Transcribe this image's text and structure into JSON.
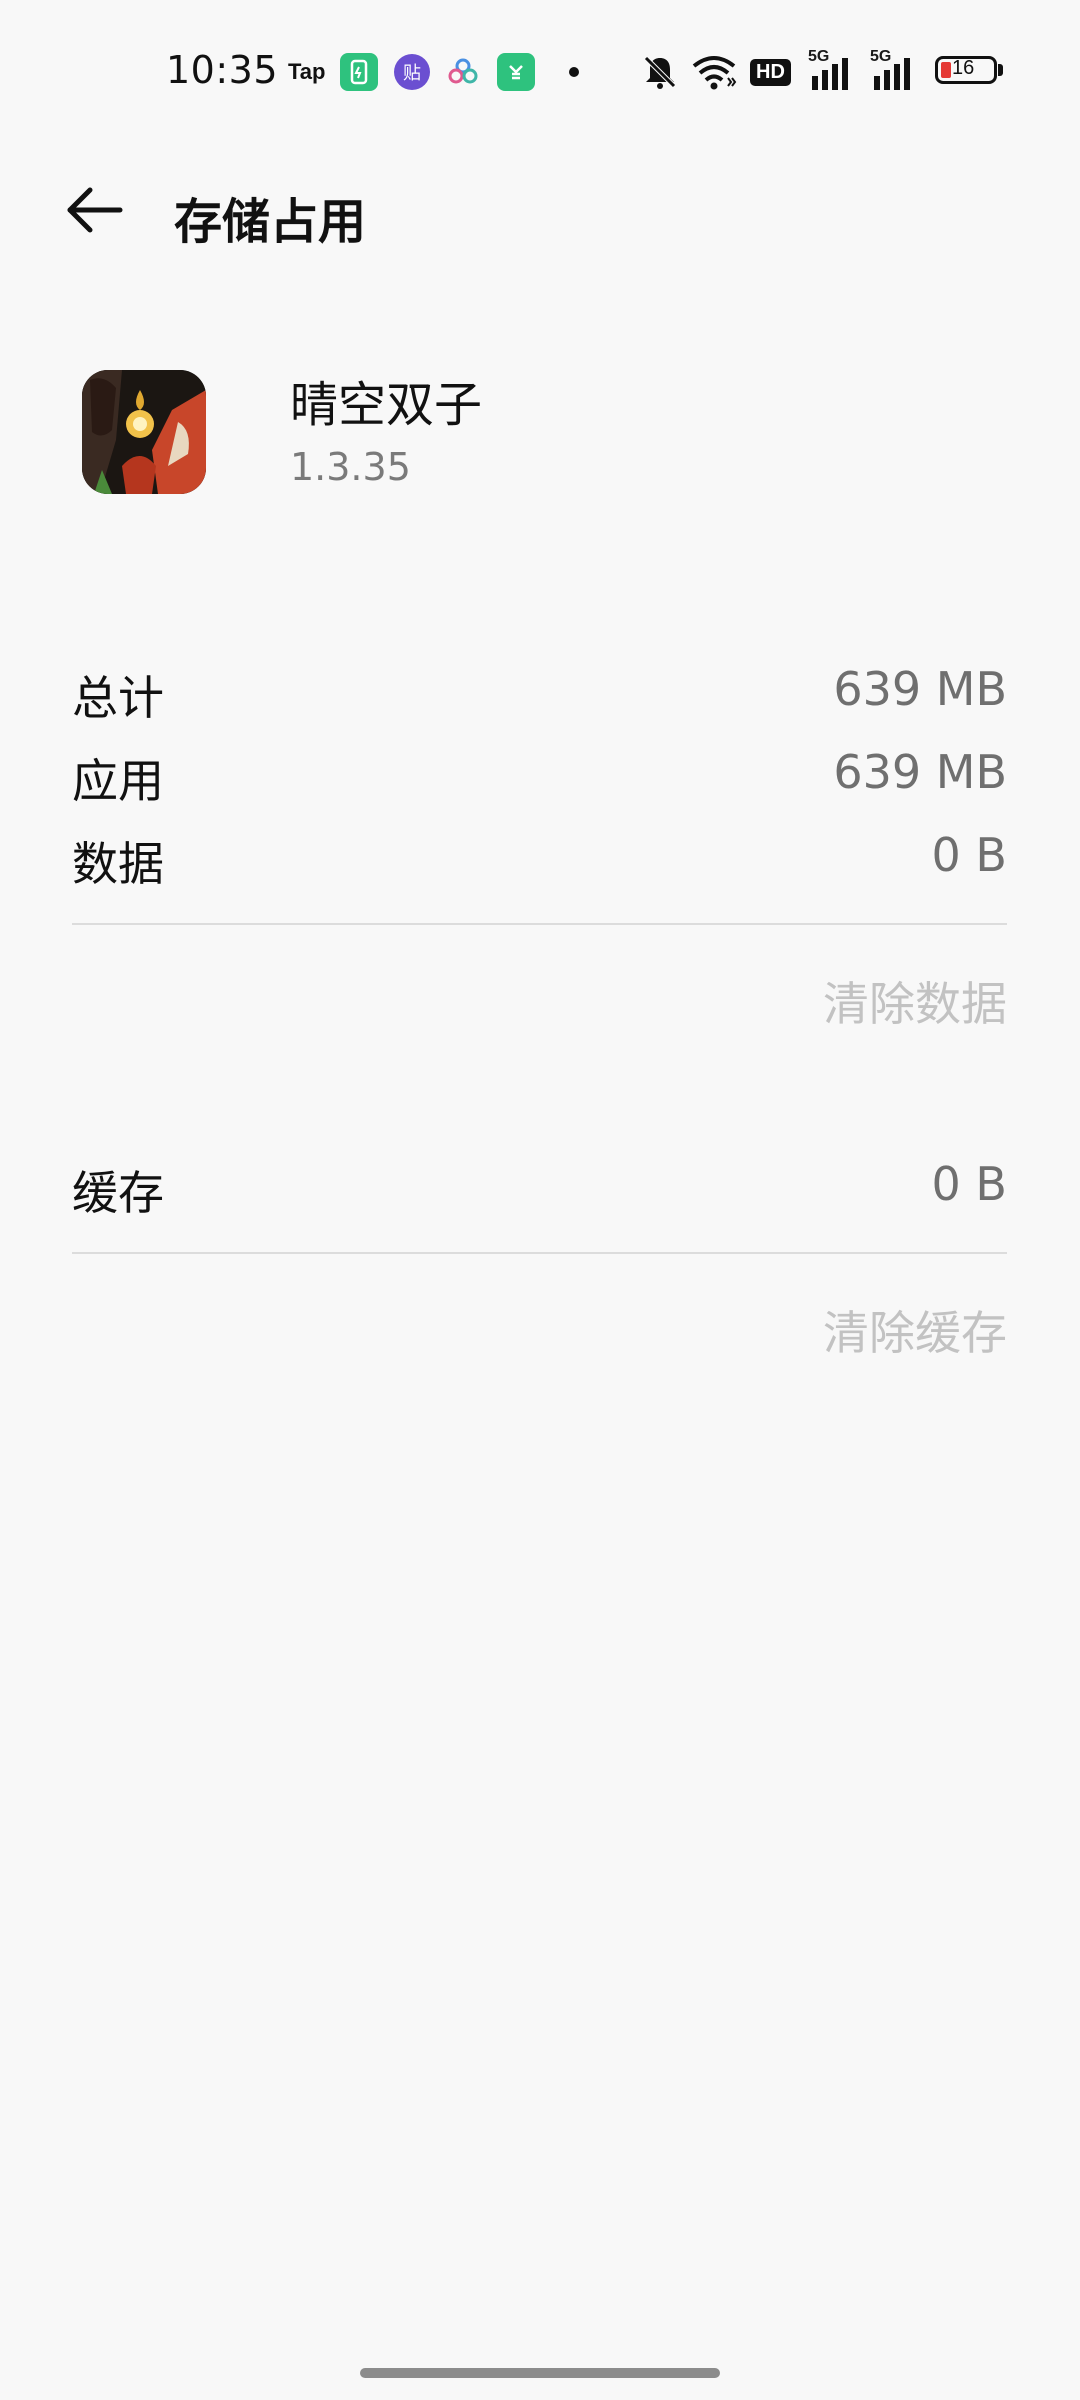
{
  "status_bar": {
    "time": "10:35",
    "tap_label": "Tap",
    "tieba_label": "贴",
    "battery_level": "16",
    "battery_color": "#e53935",
    "network_label": "5G",
    "hd_label": "HD",
    "icons": [
      "tap-app-icon",
      "green-app-icon",
      "tieba-icon",
      "cloud-app-icon",
      "green-app-icon-2",
      "notification-dot-icon",
      "mute-bell-icon",
      "wifi-icon",
      "hd-icon",
      "signal-5g-icon",
      "signal-5g-icon-2",
      "battery-icon"
    ]
  },
  "header": {
    "title": "存储占用"
  },
  "app": {
    "name": "晴空双子",
    "version": "1.3.35"
  },
  "storage": {
    "total_label": "总计",
    "total_value": "639 MB",
    "app_label": "应用",
    "app_value": "639 MB",
    "data_label": "数据",
    "data_value": "0 B",
    "clear_data_label": "清除数据",
    "cache_label": "缓存",
    "cache_value": "0 B",
    "clear_cache_label": "清除缓存"
  }
}
